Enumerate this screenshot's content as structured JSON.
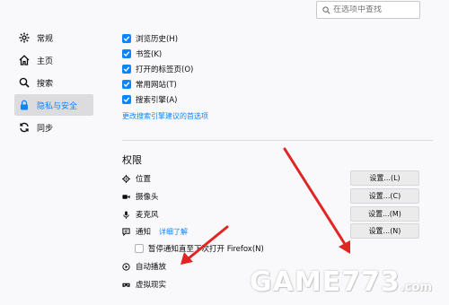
{
  "search": {
    "placeholder": "在选项中查找"
  },
  "sidebar": {
    "items": [
      {
        "label": "常规",
        "icon": "gear-icon"
      },
      {
        "label": "主页",
        "icon": "home-icon"
      },
      {
        "label": "搜索",
        "icon": "search-icon"
      },
      {
        "label": "隐私与安全",
        "icon": "lock-icon",
        "active": true
      },
      {
        "label": "同步",
        "icon": "sync-icon"
      }
    ]
  },
  "address_bar": {
    "options": [
      {
        "label": "浏览历史(H)",
        "checked": true
      },
      {
        "label": "书签(K)",
        "checked": true
      },
      {
        "label": "打开的标签页(O)",
        "checked": true
      },
      {
        "label": "常用网站(T)",
        "checked": true
      },
      {
        "label": "搜索引擎(A)",
        "checked": true
      }
    ],
    "change_link": "更改搜索引擎建议的首选项"
  },
  "permissions": {
    "title": "权限",
    "rows": [
      {
        "label": "位置",
        "icon": "location-icon",
        "button": "设置...(L)"
      },
      {
        "label": "摄像头",
        "icon": "camera-icon",
        "button": "设置...(C)"
      },
      {
        "label": "麦克风",
        "icon": "microphone-icon",
        "button": "设置...(M)"
      },
      {
        "label": "通知",
        "icon": "notification-icon",
        "button": "设置...(N)",
        "link": "详细了解"
      }
    ],
    "pause_notifications": {
      "label": "暂停通知直至下次打开 Firefox(N)",
      "checked": false
    },
    "autoplay": {
      "label": "自动播放",
      "icon": "autoplay-icon"
    },
    "vr": {
      "label": "虚拟现实",
      "icon": "vr-icon"
    }
  },
  "watermark": {
    "main": "GAME773",
    "suffix": ".com"
  },
  "colors": {
    "accent": "#0a84ff",
    "arrow": "#e02525"
  }
}
